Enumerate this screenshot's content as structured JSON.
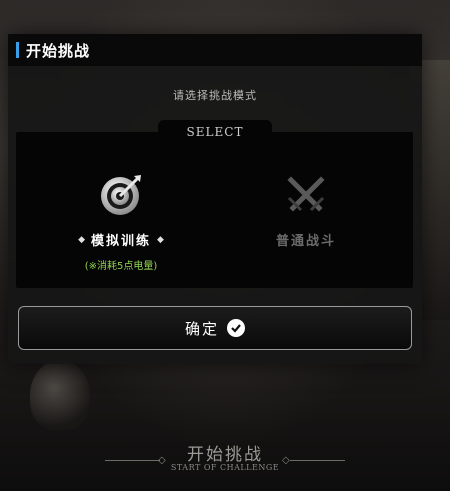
{
  "dialog": {
    "title": "开始挑战",
    "prompt": "请选择挑战模式",
    "select_tab": "SELECT",
    "modes": [
      {
        "label": "模拟训练",
        "cost": "(※消耗5点电量)",
        "icon": "target-icon",
        "selected": true
      },
      {
        "label": "普通战斗",
        "icon": "crossed-swords-icon",
        "selected": false
      }
    ],
    "confirm_label": "确定"
  },
  "footer": {
    "title": "开始挑战",
    "subtitle": "START OF CHALLENGE"
  },
  "colors": {
    "accent": "#3b9ee8",
    "cost_text": "#8fd14f",
    "disabled_text": "#6a6a6a"
  }
}
